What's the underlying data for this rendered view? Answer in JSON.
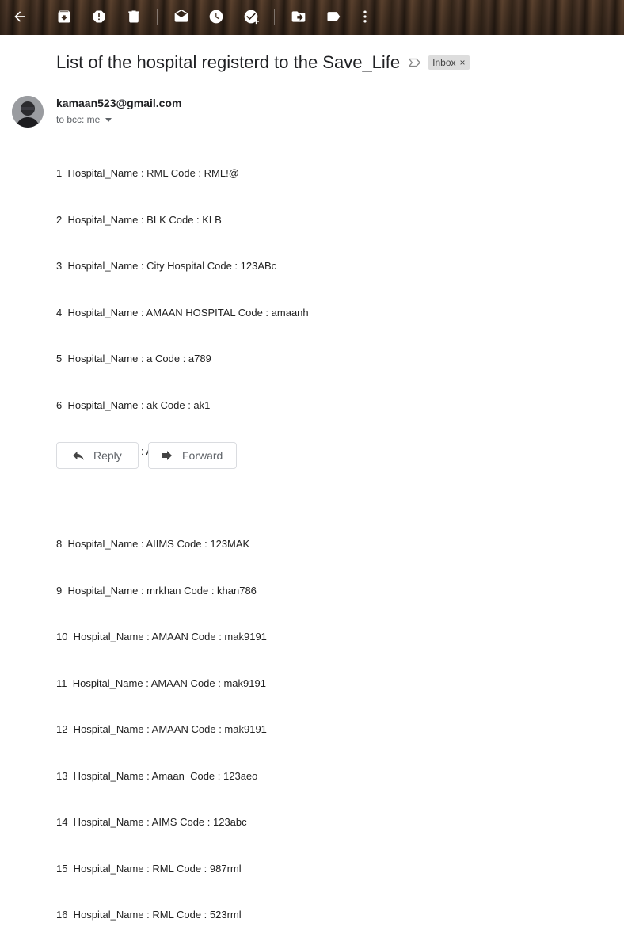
{
  "toolbar": {
    "icons": [
      "back-arrow-icon",
      "archive-icon",
      "report-spam-icon",
      "delete-icon",
      "mark-unread-icon",
      "snooze-icon",
      "add-to-tasks-icon",
      "move-to-icon",
      "labels-icon",
      "more-options-icon"
    ]
  },
  "email": {
    "subject": "List of the hospital registerd to the Save_Life",
    "label": "Inbox",
    "label_close": "×",
    "sender": "kamaan523@gmail.com",
    "recipients": "to bcc: me",
    "lines": [
      "1  Hospital_Name : RML Code : RML!@",
      "2  Hospital_Name : BLK Code : KLB",
      "3  Hospital_Name : City Hospital Code : 123ABc",
      "4  Hospital_Name : AMAAN HOSPITAL Code : amaanh",
      "5  Hospital_Name : a Code : a789",
      "6  Hospital_Name : ak Code : ak1",
      "7  Hospital_Name : AIIMS Code : AIMS",
      "",
      "8  Hospital_Name : AIIMS Code : 123MAK",
      "9  Hospital_Name : mrkhan Code : khan786",
      "10  Hospital_Name : AMAAN Code : mak9191",
      "11  Hospital_Name : AMAAN Code : mak9191",
      "12  Hospital_Name : AMAAN Code : mak9191",
      "13  Hospital_Name : Amaan  Code : 123aeo",
      "14  Hospital_Name : AIMS Code : 123abc",
      "15  Hospital_Name : RML Code : 987rml",
      "16  Hospital_Name : RML Code : 523rml"
    ]
  },
  "actions": {
    "reply_label": "Reply",
    "forward_label": "Forward"
  }
}
